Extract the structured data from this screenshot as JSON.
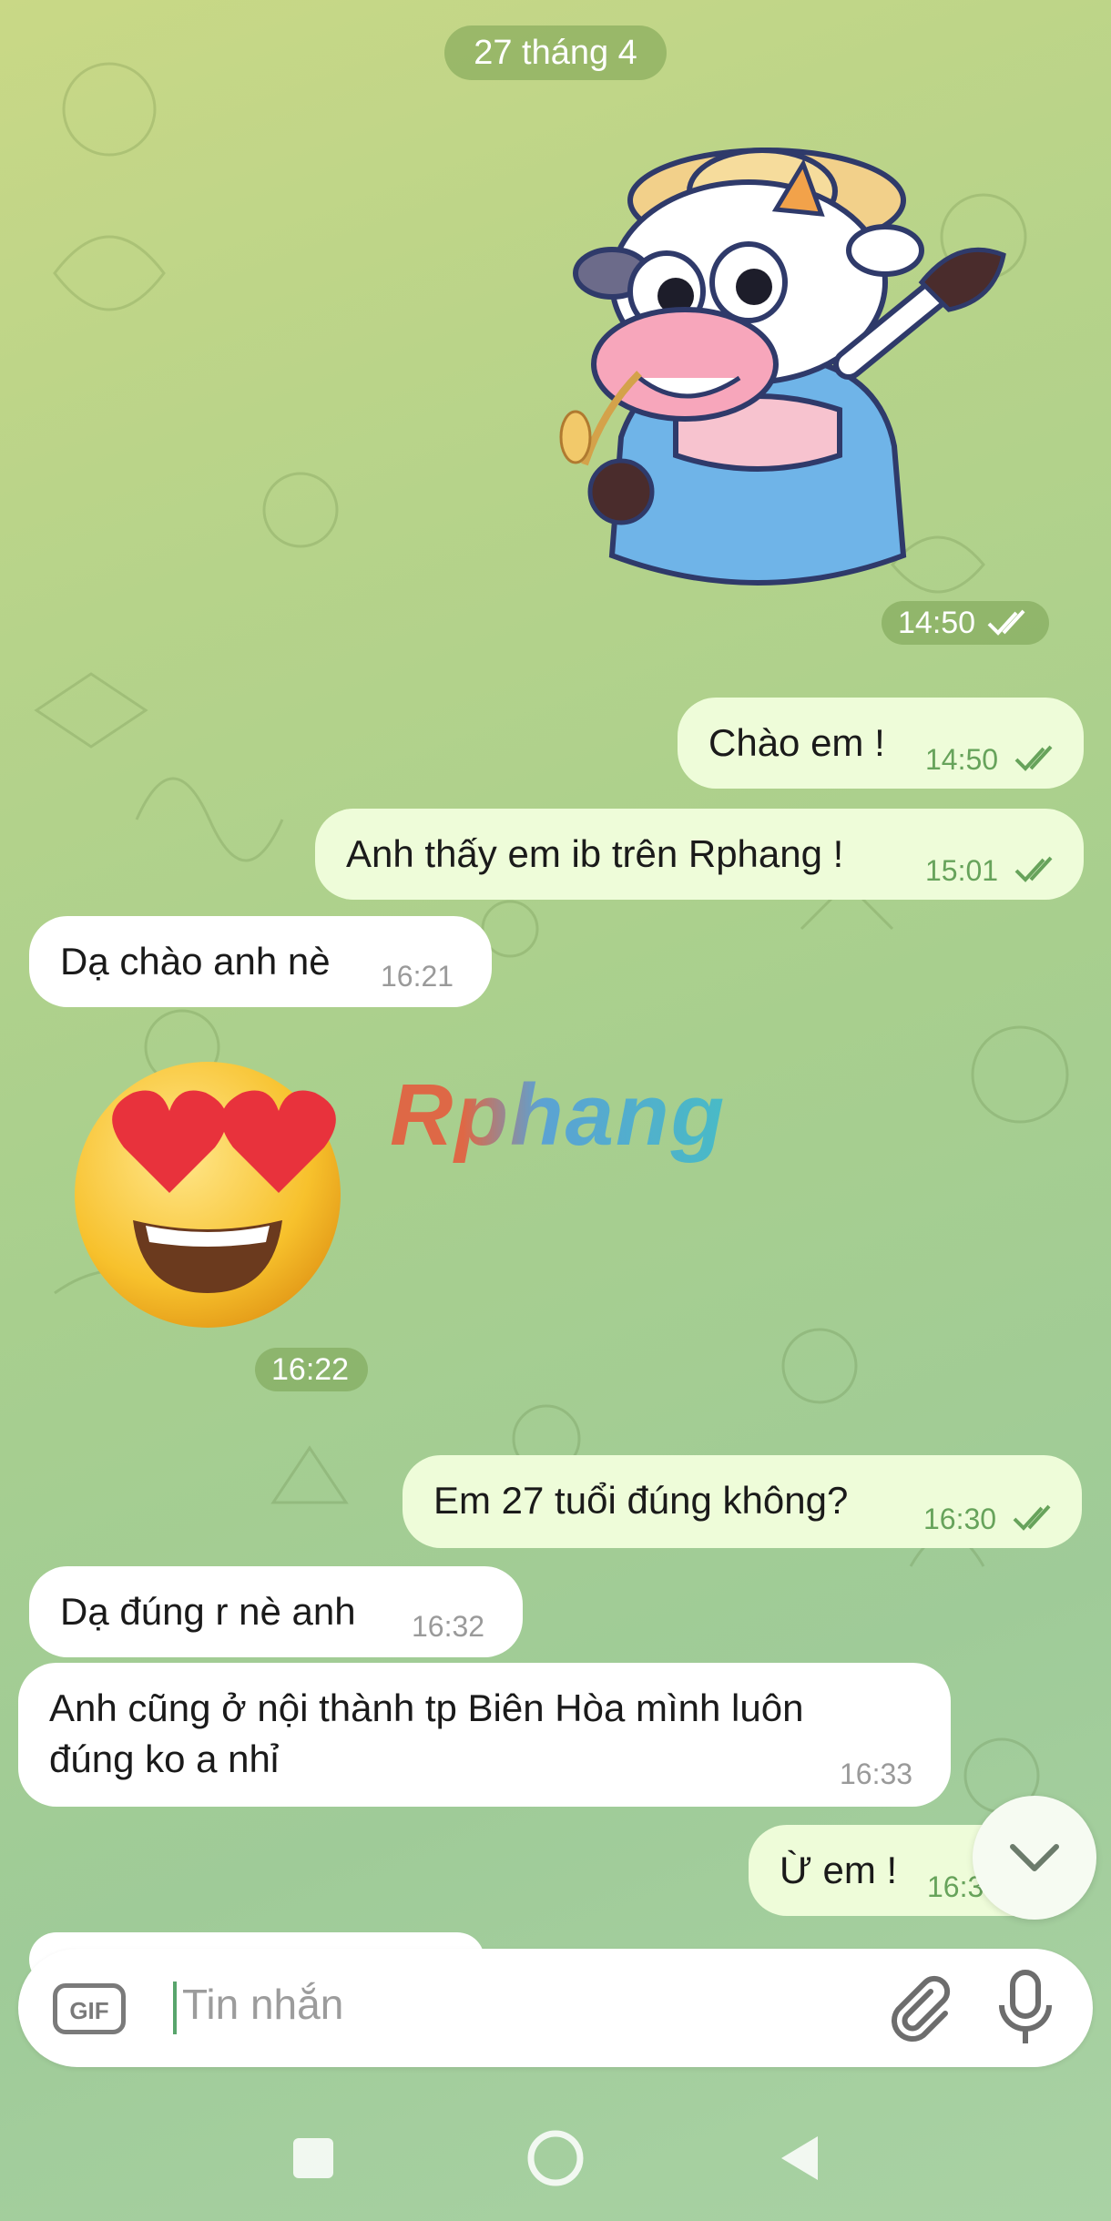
{
  "chat": {
    "date_label": "27 tháng 4",
    "sticker_time": "14:50",
    "emoji_time": "16:22",
    "messages": [
      {
        "dir": "out",
        "text": "Chào em !",
        "time": "14:50",
        "read": true
      },
      {
        "dir": "out",
        "text": "Anh thấy em ib trên Rphang !",
        "time": "15:01",
        "read": true
      },
      {
        "dir": "in",
        "text": "Dạ chào anh nè",
        "time": "16:21"
      },
      {
        "dir": "out",
        "text": "Em 27 tuổi đúng không?",
        "time": "16:30",
        "read": true
      },
      {
        "dir": "in",
        "text": "Dạ đúng r nè anh",
        "time": "16:32"
      },
      {
        "dir": "in",
        "line1": "Anh cũng ở nội thành tp Biên Hòa mình luôn",
        "line2": "đúng ko a nhỉ",
        "time": "16:33"
      },
      {
        "dir": "out",
        "text": "Ừ em !",
        "time": "16:3"
      }
    ]
  },
  "watermark": "Rphang",
  "input": {
    "gif_label": "GIF",
    "placeholder": "Tin nhắn"
  },
  "icons": {
    "sticker": "cow-sticker",
    "emoji": "heart-eyes-emoji",
    "scroll": "chevron-down-icon",
    "attach": "paperclip-icon",
    "mic": "microphone-icon"
  },
  "colors": {
    "outgoing_bubble": "#eefcd9",
    "incoming_bubble": "#ffffff",
    "read_ticks": "#67a35b",
    "pill": "#78a050"
  }
}
